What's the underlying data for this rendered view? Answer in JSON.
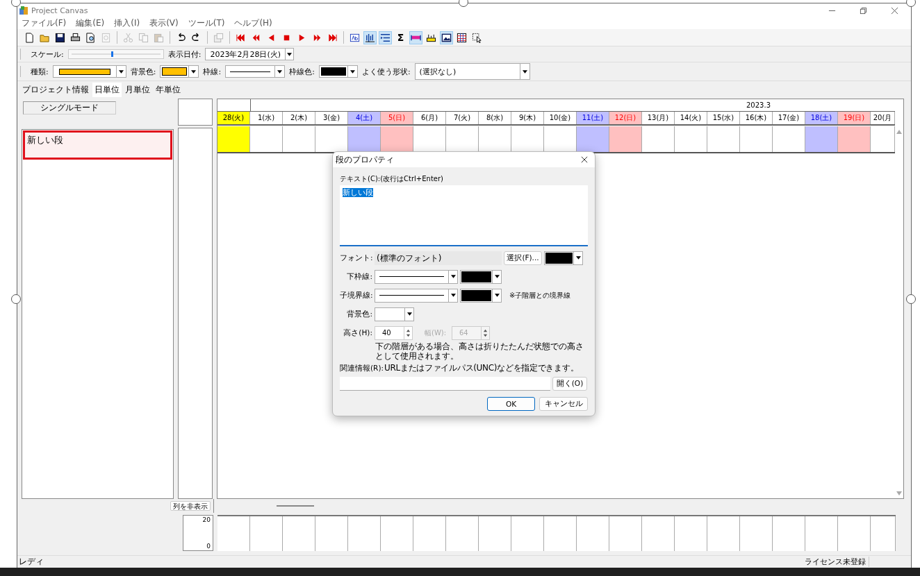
{
  "window": {
    "title": "Project Canvas"
  },
  "menu": [
    "ファイル(F)",
    "編集(E)",
    "挿入(I)",
    "表示(V)",
    "ツール(T)",
    "ヘルプ(H)"
  ],
  "toolbar": [
    {
      "kind": "new",
      "disabled": false,
      "pressed": false
    },
    {
      "kind": "open",
      "disabled": false,
      "pressed": false
    },
    {
      "kind": "save",
      "disabled": false,
      "pressed": false
    },
    {
      "kind": "print",
      "disabled": false,
      "pressed": false
    },
    {
      "kind": "preview",
      "disabled": false,
      "pressed": false
    },
    {
      "kind": "refresh",
      "disabled": true,
      "pressed": false
    },
    {
      "kind": "separator"
    },
    {
      "kind": "cut",
      "disabled": true,
      "pressed": false
    },
    {
      "kind": "copy",
      "disabled": true,
      "pressed": false
    },
    {
      "kind": "paste",
      "disabled": true,
      "pressed": false
    },
    {
      "kind": "separator"
    },
    {
      "kind": "undo",
      "disabled": false,
      "pressed": false
    },
    {
      "kind": "redo",
      "disabled": false,
      "pressed": false
    },
    {
      "kind": "separator"
    },
    {
      "kind": "properties",
      "disabled": true,
      "pressed": false
    },
    {
      "kind": "separator"
    },
    {
      "kind": "first",
      "disabled": false,
      "pressed": false
    },
    {
      "kind": "rewind",
      "disabled": false,
      "pressed": false
    },
    {
      "kind": "prev",
      "disabled": false,
      "pressed": false
    },
    {
      "kind": "stop",
      "disabled": false,
      "pressed": false
    },
    {
      "kind": "play",
      "disabled": false,
      "pressed": false
    },
    {
      "kind": "forward",
      "disabled": false,
      "pressed": false
    },
    {
      "kind": "last",
      "disabled": false,
      "pressed": false
    },
    {
      "kind": "separator"
    },
    {
      "kind": "textbox",
      "disabled": false,
      "pressed": false
    },
    {
      "kind": "columns",
      "disabled": false,
      "pressed": true
    },
    {
      "kind": "indent",
      "disabled": false,
      "pressed": true
    },
    {
      "kind": "glyph",
      "label": "Σ",
      "disabled": false,
      "pressed": false
    },
    {
      "kind": "bar",
      "disabled": false,
      "pressed": true
    },
    {
      "kind": "ruler",
      "disabled": false,
      "pressed": false
    },
    {
      "kind": "picture",
      "disabled": false,
      "pressed": true
    },
    {
      "kind": "table",
      "disabled": false,
      "pressed": false
    },
    {
      "kind": "pointer",
      "disabled": false,
      "pressed": false
    }
  ],
  "scale_bar": {
    "label": "スケール:",
    "level": 0.45,
    "date_label": "表示日付:",
    "date_value": "2023年2月28日(火)"
  },
  "shape_bar": {
    "type_label": "種類:",
    "bg_label": "背景色:",
    "border_label": "枠線:",
    "border_color_label": "枠線色:",
    "common_label": "よく使う形状:",
    "common_value": "(選択なし)"
  },
  "tabs": [
    {
      "label": "プロジェクト情報",
      "selected": false
    },
    {
      "label": "日単位",
      "selected": true
    },
    {
      "label": "月単位",
      "selected": false
    },
    {
      "label": "年単位",
      "selected": false
    }
  ],
  "mode_label": "シングルモード",
  "rows": [
    {
      "label": "新しい段",
      "selected": true
    }
  ],
  "month_label": "2023.3",
  "days": [
    {
      "label": "28(火)",
      "kind": "today"
    },
    {
      "label": "1(水)",
      "kind": "weekday"
    },
    {
      "label": "2(木)",
      "kind": "weekday"
    },
    {
      "label": "3(金)",
      "kind": "weekday"
    },
    {
      "label": "4(土)",
      "kind": "saturday"
    },
    {
      "label": "5(日)",
      "kind": "sunday"
    },
    {
      "label": "6(月)",
      "kind": "weekday"
    },
    {
      "label": "7(火)",
      "kind": "weekday"
    },
    {
      "label": "8(水)",
      "kind": "weekday"
    },
    {
      "label": "9(木)",
      "kind": "weekday"
    },
    {
      "label": "10(金)",
      "kind": "weekday"
    },
    {
      "label": "11(土)",
      "kind": "saturday"
    },
    {
      "label": "12(日)",
      "kind": "sunday"
    },
    {
      "label": "13(月)",
      "kind": "weekday"
    },
    {
      "label": "14(火)",
      "kind": "weekday"
    },
    {
      "label": "15(水)",
      "kind": "weekday"
    },
    {
      "label": "16(木)",
      "kind": "weekday"
    },
    {
      "label": "17(金)",
      "kind": "weekday"
    },
    {
      "label": "18(土)",
      "kind": "saturday"
    },
    {
      "label": "19(日)",
      "kind": "sunday"
    },
    {
      "label": "20(月",
      "kind": "weekday"
    }
  ],
  "hide_columns_button": "列を非表示",
  "load_axis": [
    "20",
    "0"
  ],
  "status_bar": {
    "left": "レディ",
    "right": "ライセンス未登録"
  },
  "dialog": {
    "title": "段のプロパティ",
    "text_label": "テキスト(C):(改行はCtrl+Enter)",
    "text_value": "新しい段",
    "font_label": "フォント:",
    "font_value": "(標準のフォント)",
    "font_button": "選択(F)...",
    "bottom_line_label": "下枠線:",
    "child_line_label": "子境界線:",
    "child_line_note": "※子階層との境界線",
    "bg_label": "背景色:",
    "height_label": "高さ(H):",
    "height_value": "40",
    "width_label": "幅(W):",
    "width_value": "64",
    "width_disabled": true,
    "height_note": "下の階層がある場合、高さは折りたたんだ状態での高さとして使用されます。",
    "link_label": "関連情報(R):",
    "link_hint": "URLまたはファイルパス(UNC)などを指定できます。",
    "open_button": "開く(O)",
    "ok_button": "OK",
    "cancel_button": "キャンセル"
  }
}
